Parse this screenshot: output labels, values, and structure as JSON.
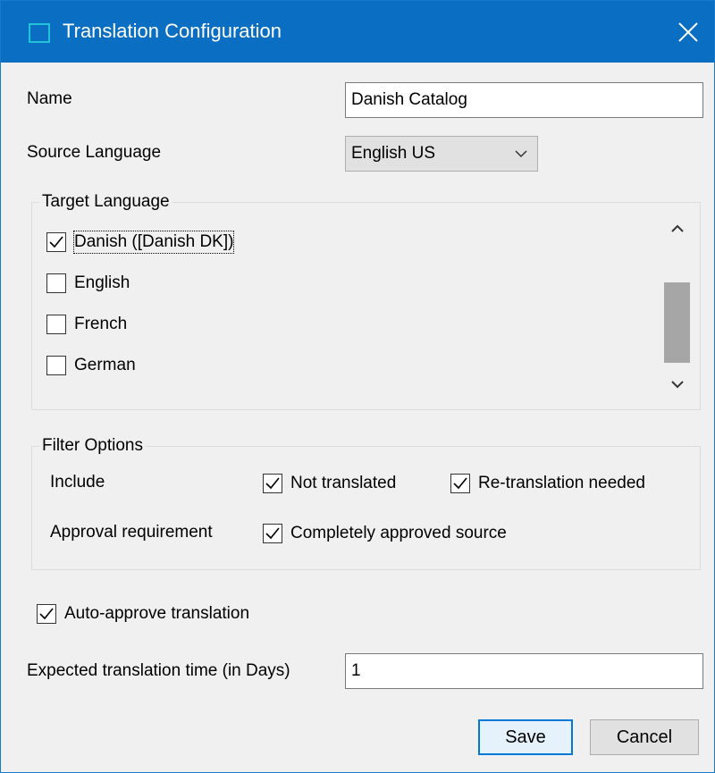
{
  "window": {
    "title": "Translation Configuration"
  },
  "form": {
    "name_label": "Name",
    "name_value": "Danish Catalog",
    "source_language_label": "Source Language",
    "source_language_value": "English US",
    "target_language": {
      "legend": "Target Language",
      "items": [
        {
          "label": "Danish ([Danish DK])",
          "checked": true,
          "focused": true
        },
        {
          "label": "English",
          "checked": false
        },
        {
          "label": "French",
          "checked": false
        },
        {
          "label": "German",
          "checked": false
        }
      ]
    },
    "filter_options": {
      "legend": "Filter Options",
      "include_label": "Include",
      "not_translated": {
        "label": "Not translated",
        "checked": true
      },
      "retranslation_needed": {
        "label": "Re-translation needed",
        "checked": true
      },
      "approval_label": "Approval requirement",
      "completely_approved": {
        "label": "Completely approved source",
        "checked": true
      }
    },
    "auto_approve": {
      "label": "Auto-approve translation",
      "checked": true
    },
    "expected_time_label": "Expected translation time (in Days)",
    "expected_time_value": "1"
  },
  "buttons": {
    "save": "Save",
    "cancel": "Cancel"
  },
  "colors": {
    "titlebar": "#0a6fc2",
    "accent": "#0078d7",
    "background": "#f0f0f0"
  },
  "icons": {
    "app": "window-icon",
    "close": "close-icon",
    "check": "checkmark-icon"
  }
}
